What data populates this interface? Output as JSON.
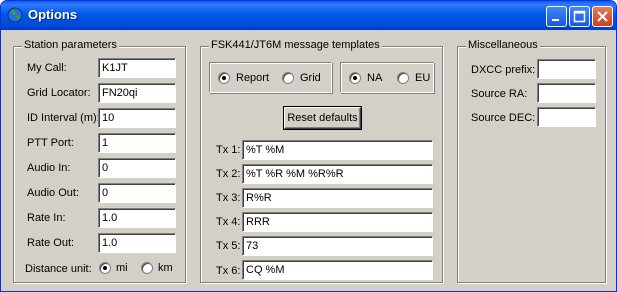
{
  "window": {
    "title": "Options"
  },
  "station": {
    "legend": "Station parameters",
    "fields": [
      {
        "label": "My Call:",
        "value": "K1JT"
      },
      {
        "label": "Grid Locator:",
        "value": "FN20qi"
      },
      {
        "label": "ID Interval (m):",
        "value": "10"
      },
      {
        "label": "PTT Port:",
        "value": "1"
      },
      {
        "label": "Audio In:",
        "value": "0"
      },
      {
        "label": "Audio Out:",
        "value": "0"
      },
      {
        "label": "Rate In:",
        "value": "1.0"
      },
      {
        "label": "Rate Out:",
        "value": "1.0"
      }
    ],
    "distance_label": "Distance unit:",
    "distance_mi": "mi",
    "distance_km": "km",
    "distance_selected": "mi"
  },
  "templates": {
    "legend": "FSK441/JT6M message templates",
    "report_label": "Report",
    "grid_label": "Grid",
    "report_grid_selected": "Report",
    "na_label": "NA",
    "eu_label": "EU",
    "region_selected": "NA",
    "reset_label": "Reset defaults",
    "tx": [
      {
        "label": "Tx 1:",
        "value": "%T %M"
      },
      {
        "label": "Tx 2:",
        "value": "%T %R %M %R%R"
      },
      {
        "label": "Tx 3:",
        "value": "R%R"
      },
      {
        "label": "Tx 4:",
        "value": "RRR"
      },
      {
        "label": "Tx 5:",
        "value": "73"
      },
      {
        "label": "Tx 6:",
        "value": "CQ %M"
      }
    ]
  },
  "misc": {
    "legend": "Miscellaneous",
    "fields": [
      {
        "label": "DXCC prefix:",
        "value": ""
      },
      {
        "label": "Source RA:",
        "value": ""
      },
      {
        "label": "Source DEC:",
        "value": ""
      }
    ]
  },
  "colors": {
    "titlebar": "#0058e6",
    "face": "#d4d0c8",
    "close": "#c8401e"
  }
}
